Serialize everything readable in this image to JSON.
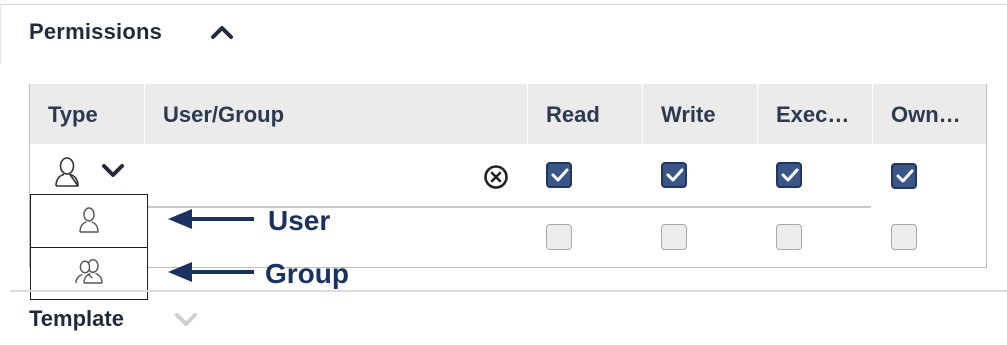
{
  "permissions": {
    "title": "Permissions",
    "columns": [
      "Type",
      "User/Group",
      "Read",
      "Write",
      "Exec…",
      "Own…"
    ],
    "rows": [
      {
        "type_icon": "user-icon",
        "read": true,
        "write": true,
        "exec": true,
        "own": true
      },
      {
        "type_icon": "none",
        "read": false,
        "write": false,
        "exec": false,
        "own": false
      }
    ]
  },
  "type_dropdown": {
    "options": [
      {
        "icon": "user-icon"
      },
      {
        "icon": "group-icon"
      }
    ]
  },
  "annotations": {
    "user_label": "User",
    "group_label": "Group"
  },
  "template": {
    "title": "Template"
  },
  "colors": {
    "checkbox_checked": "#3a5688",
    "header_bg": "#ebebeb",
    "annotation": "#1b3260"
  }
}
